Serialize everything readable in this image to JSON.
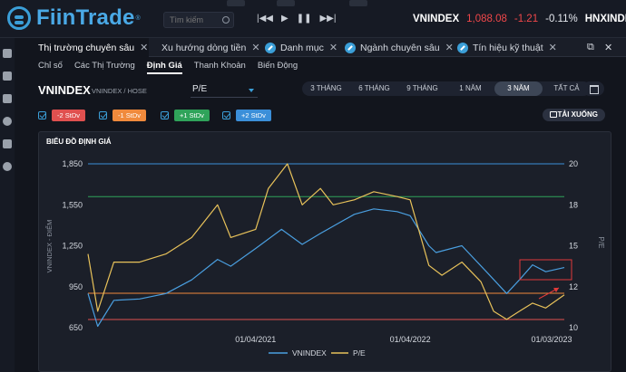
{
  "app": {
    "logo": "FiinTrade",
    "logo_reg": "®"
  },
  "search": {
    "placeholder": "Tìm kiếm"
  },
  "player": {
    "prev": "|◀◀",
    "play": "▶",
    "pause": "❚❚",
    "next": "▶▶|"
  },
  "ticker": [
    {
      "name": "VNINDEX",
      "price": "1,088.08",
      "change": "-1.21",
      "pct": "-0.11%"
    },
    {
      "name": "HNXINDEX"
    }
  ],
  "tabs": [
    {
      "label": "Thị trường chuyên sâu",
      "close": "✕",
      "active": true
    },
    {
      "label": "Xu hướng dòng tiền",
      "close": "✕"
    },
    {
      "label": "Danh mục",
      "close": "✕",
      "badge": true
    },
    {
      "label": "Ngành chuyên sâu",
      "close": "✕",
      "badge": true
    },
    {
      "label": "Tín hiệu kỹ thuật",
      "close": "✕",
      "badge": true
    }
  ],
  "window_controls": {
    "popout": "⧉",
    "close": "✕"
  },
  "subtabs": [
    "Chỉ số",
    "Các Thị Trường",
    "Định Giá",
    "Thanh Khoản",
    "Biến Động"
  ],
  "active_subtab": "Định Giá",
  "header": {
    "title": "VNINDEX",
    "subtitle": "VNINDEX / HOSE",
    "metric": "P/E"
  },
  "periods": [
    "3 THÁNG",
    "6 THÁNG",
    "9 THÁNG",
    "1 NĂM",
    "3 NĂM",
    "TẤT CẢ"
  ],
  "active_period": "3 NĂM",
  "std_toggles": [
    {
      "label": "-2 StDv",
      "color": "#e0504f"
    },
    {
      "label": "-1 StDv",
      "color": "#f08a3c"
    },
    {
      "label": "+1 StDv",
      "color": "#2fa35a"
    },
    {
      "label": "+2 StDv",
      "color": "#3b8fd9"
    }
  ],
  "download_label": "TẢI XUỐNG",
  "colors": {
    "vnindex": "#4a9fe0",
    "pe": "#e8c25a",
    "annotation": "#e03a3a"
  },
  "chart_data": {
    "type": "line",
    "title": "BIỂU ĐỒ ĐỊNH GIÁ",
    "ylabel_left": "VNINDEX - ĐIỂM",
    "ylabel_right": "P/E",
    "ylim_left": [
      650,
      1850
    ],
    "ylim_right": [
      10,
      20
    ],
    "yticks_left": [
      "1,850",
      "1,550",
      "1,250",
      "950",
      "650"
    ],
    "yticks_right": [
      "20",
      "18",
      "15",
      "12",
      "10"
    ],
    "xticks": [
      "01/04/2021",
      "01/04/2022",
      "01/03/2023"
    ],
    "x_range": [
      "2020-03-01",
      "2023-03-31"
    ],
    "legend": [
      {
        "name": "VNINDEX"
      },
      {
        "name": "P/E"
      }
    ],
    "series": [
      {
        "name": "VNINDEX",
        "x": [
          "2020-03-01",
          "2020-03-24",
          "2020-05-01",
          "2020-07-01",
          "2020-09-01",
          "2020-11-01",
          "2021-01-01",
          "2021-02-01",
          "2021-04-01",
          "2021-06-01",
          "2021-07-20",
          "2021-09-01",
          "2021-11-20",
          "2022-01-05",
          "2022-03-01",
          "2022-04-01",
          "2022-05-15",
          "2022-06-01",
          "2022-08-01",
          "2022-10-01",
          "2022-11-15",
          "2022-12-15",
          "2023-01-15",
          "2023-02-15",
          "2023-03-31"
        ],
        "values": [
          900,
          660,
          850,
          860,
          900,
          1000,
          1150,
          1100,
          1230,
          1370,
          1260,
          1340,
          1480,
          1520,
          1500,
          1470,
          1250,
          1200,
          1250,
          1050,
          900,
          1000,
          1110,
          1060,
          1090
        ]
      },
      {
        "name": "P/E",
        "x": [
          "2020-03-01",
          "2020-03-24",
          "2020-05-01",
          "2020-07-01",
          "2020-09-01",
          "2020-11-01",
          "2021-01-01",
          "2021-02-01",
          "2021-04-01",
          "2021-05-01",
          "2021-06-15",
          "2021-07-20",
          "2021-09-01",
          "2021-10-01",
          "2021-11-20",
          "2022-01-05",
          "2022-03-01",
          "2022-04-01",
          "2022-05-15",
          "2022-06-15",
          "2022-08-01",
          "2022-09-15",
          "2022-10-15",
          "2022-11-15",
          "2022-12-15",
          "2023-01-15",
          "2023-02-15",
          "2023-03-31"
        ],
        "values": [
          14.5,
          11.0,
          14.0,
          14.0,
          14.5,
          15.5,
          17.5,
          15.5,
          16.0,
          18.5,
          20.0,
          17.5,
          18.5,
          17.5,
          17.8,
          18.3,
          18.0,
          17.8,
          13.8,
          13.2,
          14.0,
          12.8,
          11.0,
          10.5,
          11.0,
          11.5,
          11.2,
          12.0
        ]
      }
    ],
    "reference_lines_pe": [
      {
        "value": 20,
        "color": "#3b8fd9"
      },
      {
        "value": 18,
        "color": "#2fa35a"
      },
      {
        "value": 12.1,
        "color": "#f08a3c"
      },
      {
        "value": 10.5,
        "color": "#e0504f"
      }
    ]
  }
}
